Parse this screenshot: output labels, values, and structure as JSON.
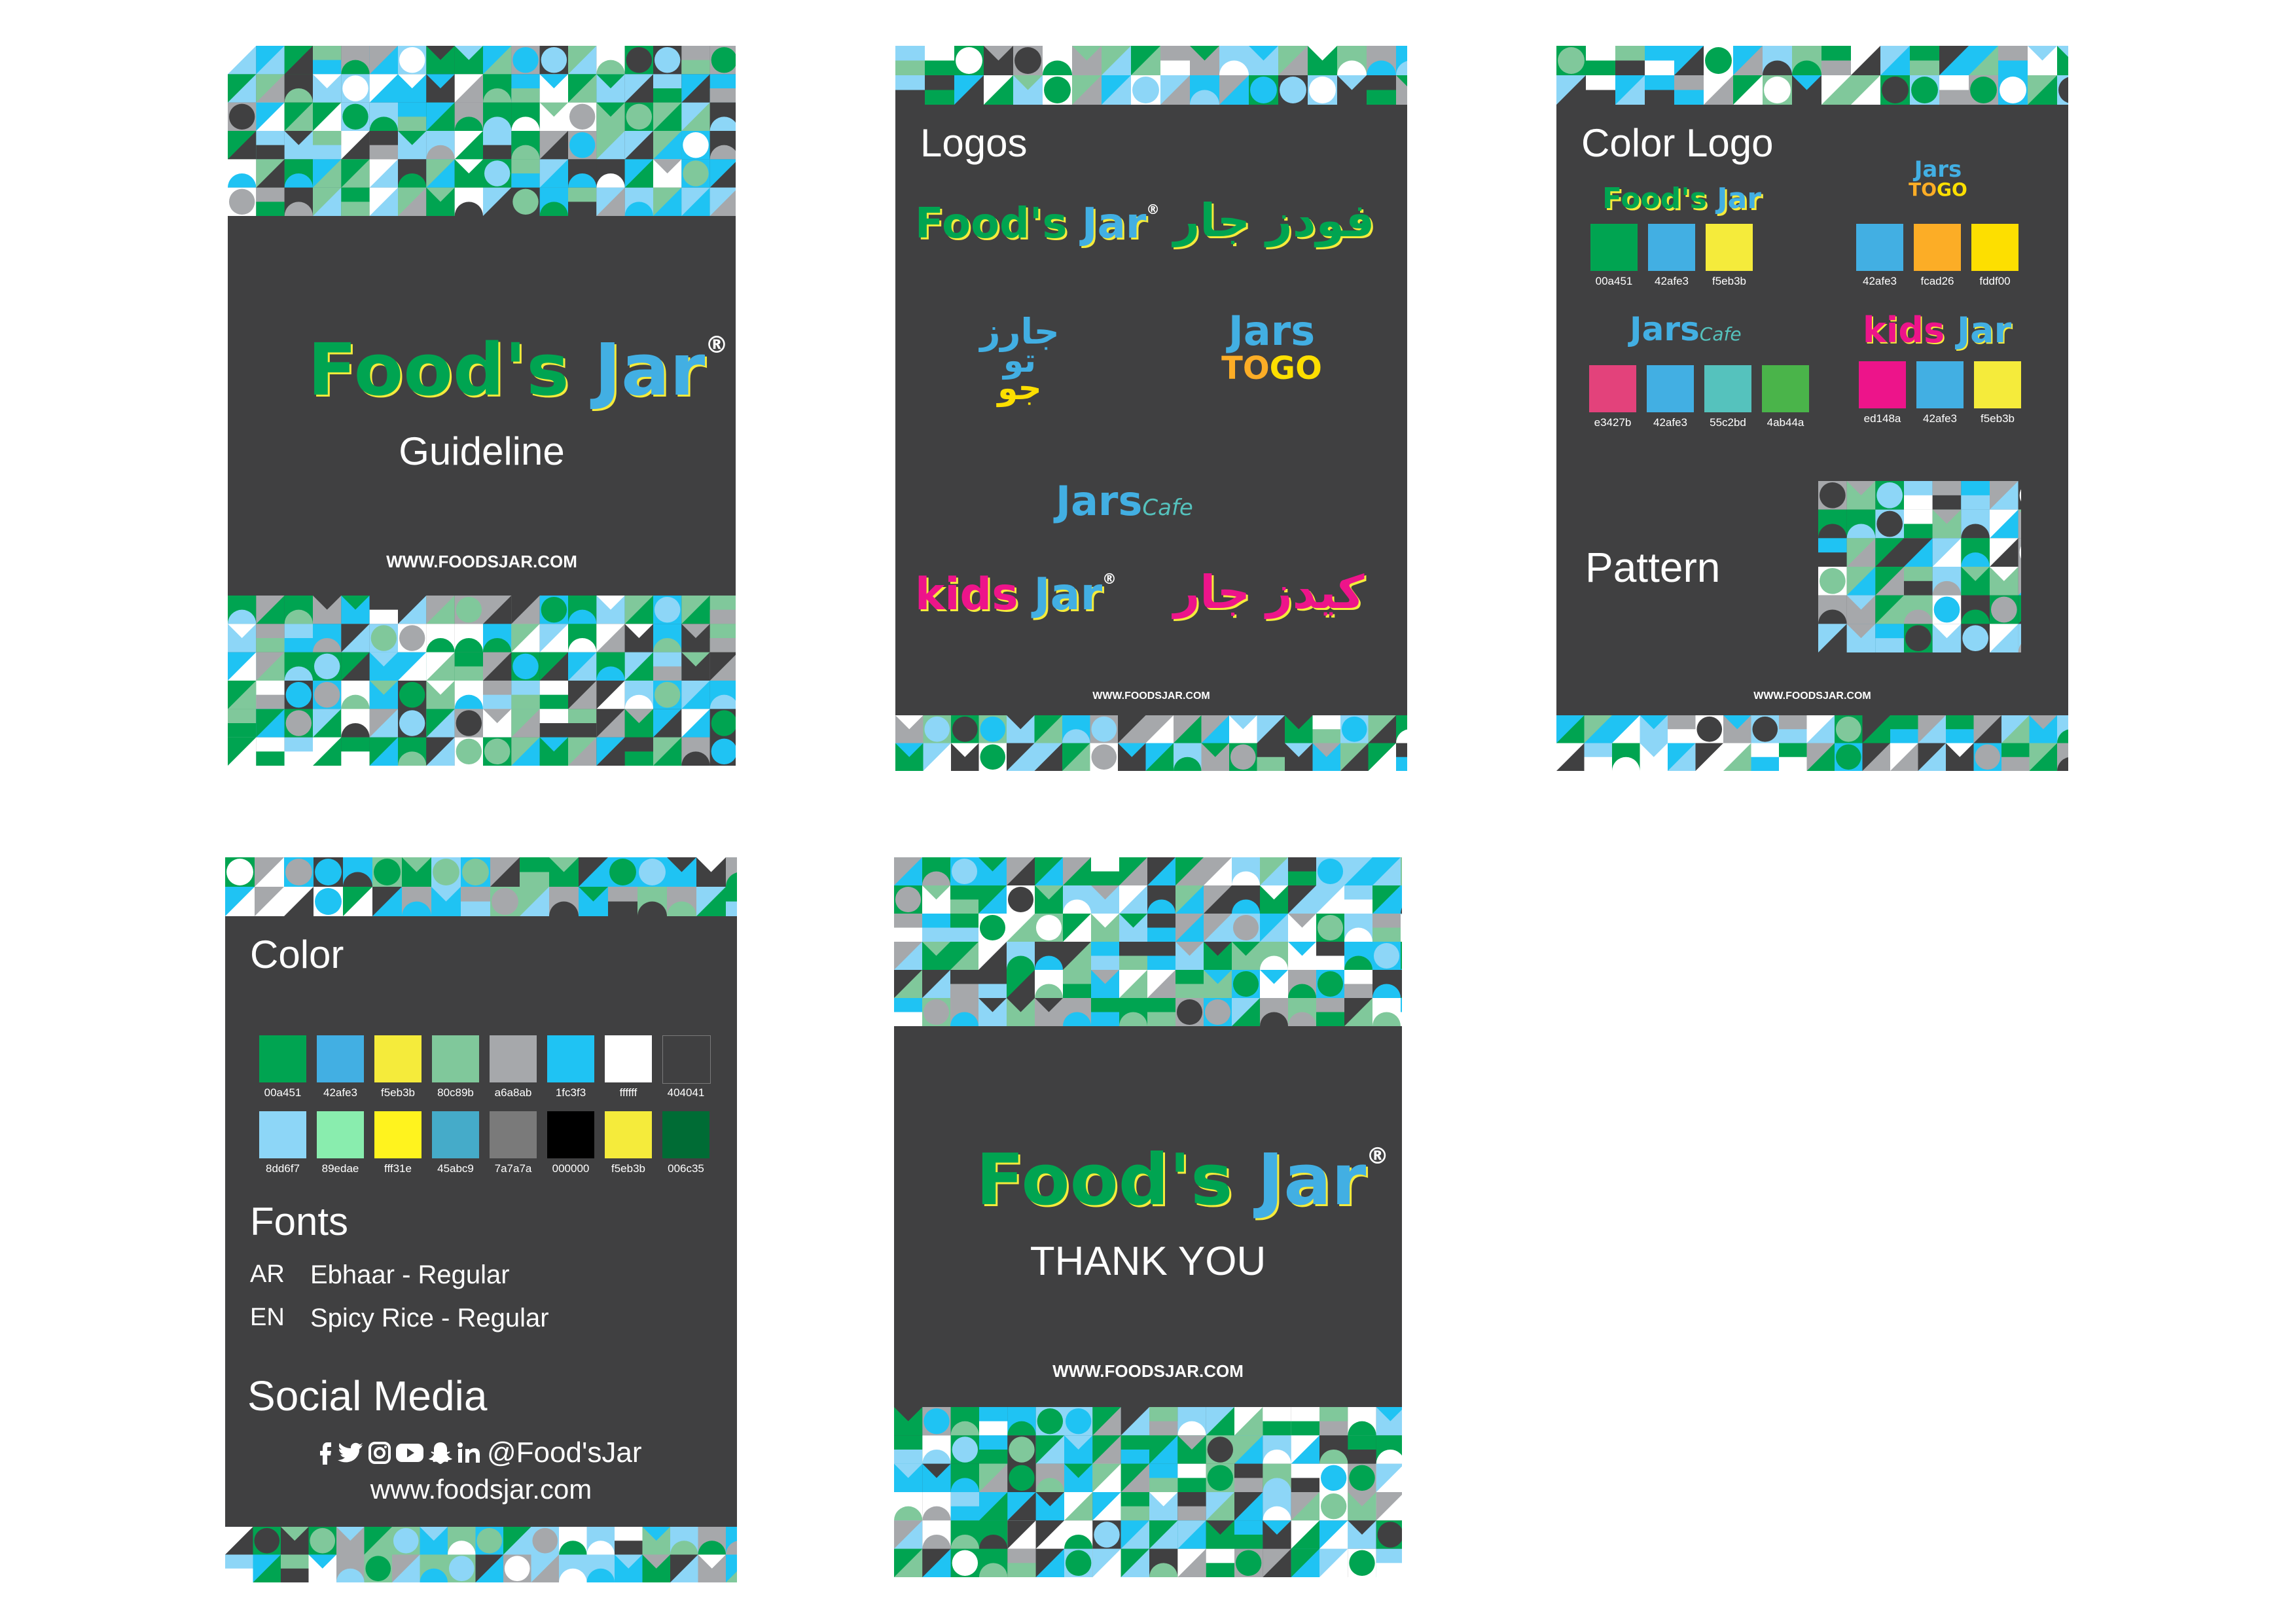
{
  "brand": {
    "name_part1": "Food's",
    "name_part2": "Jar",
    "reg_mark": "®",
    "website_caps": "WWW.FOODSJAR.COM",
    "website": "www.foodsjar.com",
    "handle": "@Food'sJar"
  },
  "cover": {
    "subtitle": "Guideline"
  },
  "logos_page": {
    "title": "Logos",
    "arabic_foodsjar": "فودز جار",
    "arabic_jarstogo_1": "جارز",
    "arabic_jarstogo_2": "تو",
    "arabic_jarstogo_3": "جو",
    "jars": "Jars",
    "to": "TO",
    "go": "GO",
    "cafe": "Cafe",
    "kids": "kids",
    "jar": "Jar",
    "arabic_kidsjar": "كيدز جار"
  },
  "color_logo_page": {
    "title": "Color Logo",
    "pattern_title": "Pattern",
    "groups": [
      {
        "logo": "foodsjar",
        "swatches": [
          {
            "hex": "#00a451",
            "label": "00a451"
          },
          {
            "hex": "#42afe3",
            "label": "42afe3"
          },
          {
            "hex": "#f5eb3b",
            "label": "f5eb3b"
          }
        ]
      },
      {
        "logo": "jarstogo",
        "swatches": [
          {
            "hex": "#42afe3",
            "label": "42afe3"
          },
          {
            "hex": "#fcad26",
            "label": "fcad26"
          },
          {
            "hex": "#fddf00",
            "label": "fddf00"
          }
        ]
      },
      {
        "logo": "jarscafe",
        "swatches": [
          {
            "hex": "#e3427b",
            "label": "e3427b"
          },
          {
            "hex": "#42afe3",
            "label": "42afe3"
          },
          {
            "hex": "#55c2bd",
            "label": "55c2bd"
          },
          {
            "hex": "#4ab44a",
            "label": "4ab44a"
          }
        ]
      },
      {
        "logo": "kidsjar",
        "swatches": [
          {
            "hex": "#ed148a",
            "label": "ed148a"
          },
          {
            "hex": "#42afe3",
            "label": "42afe3"
          },
          {
            "hex": "#f5eb3b",
            "label": "f5eb3b"
          }
        ]
      }
    ]
  },
  "color_page": {
    "title": "Color",
    "row1": [
      {
        "hex": "#00a451",
        "label": "00a451"
      },
      {
        "hex": "#42afe3",
        "label": "42afe3"
      },
      {
        "hex": "#f5eb3b",
        "label": "f5eb3b"
      },
      {
        "hex": "#80c89b",
        "label": "80c89b"
      },
      {
        "hex": "#a6a8ab",
        "label": "a6a8ab"
      },
      {
        "hex": "#1fc3f3",
        "label": "1fc3f3"
      },
      {
        "hex": "#ffffff",
        "label": "ffffff"
      },
      {
        "hex": "#404041",
        "label": "404041"
      }
    ],
    "row2": [
      {
        "hex": "#8dd6f7",
        "label": "8dd6f7"
      },
      {
        "hex": "#89edae",
        "label": "89edae"
      },
      {
        "hex": "#fff31e",
        "label": "fff31e"
      },
      {
        "hex": "#45abc9",
        "label": "45abc9"
      },
      {
        "hex": "#7a7a7a",
        "label": "7a7a7a"
      },
      {
        "hex": "#000000",
        "label": "000000"
      },
      {
        "hex": "#f5eb3b",
        "label": "f5eb3b"
      },
      {
        "hex": "#006c35",
        "label": "006c35"
      }
    ],
    "fonts_title": "Fonts",
    "font_ar_code": "AR",
    "font_ar_name": "Ebhaar - Regular",
    "font_en_code": "EN",
    "font_en_name": "Spicy Rice - Regular",
    "social_title": "Social Media",
    "social_icons": [
      "facebook-icon",
      "twitter-icon",
      "instagram-icon",
      "youtube-icon",
      "snapchat-icon",
      "linkedin-icon"
    ]
  },
  "thankyou_page": {
    "text": "THANK YOU"
  },
  "pattern_palette": [
    "#00a451",
    "#1fc3f3",
    "#80c89b",
    "#8dd6f7",
    "#a6a8ab",
    "#ffffff",
    "#404041"
  ]
}
